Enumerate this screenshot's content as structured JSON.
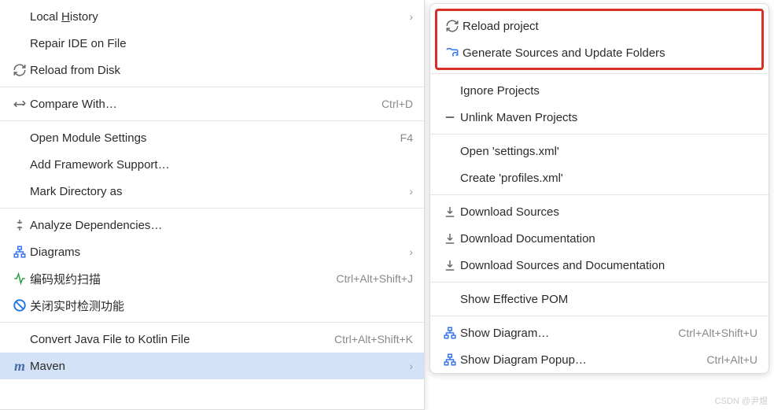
{
  "leftMenu": {
    "localHistory": "Local History",
    "repairIde": "Repair IDE on File",
    "reloadFromDisk": "Reload from Disk",
    "compareWith": "Compare With…",
    "compareWithShortcut": "Ctrl+D",
    "openModuleSettings": "Open Module Settings",
    "openModuleShortcut": "F4",
    "addFramework": "Add Framework Support…",
    "markDirectory": "Mark Directory as",
    "analyzeDeps": "Analyze Dependencies…",
    "diagrams": "Diagrams",
    "codeScan": "编码规约扫描",
    "codeScanShortcut": "Ctrl+Alt+Shift+J",
    "disableRealtime": "关闭实时检测功能",
    "convertKotlin": "Convert Java File to Kotlin File",
    "convertKotlinShortcut": "Ctrl+Alt+Shift+K",
    "maven": "Maven"
  },
  "rightMenu": {
    "reloadProject": "Reload project",
    "generateSources": "Generate Sources and Update Folders",
    "ignoreProjects": "Ignore Projects",
    "unlinkMaven": "Unlink Maven Projects",
    "openSettings": "Open 'settings.xml'",
    "createProfiles": "Create 'profiles.xml'",
    "downloadSources": "Download Sources",
    "downloadDocs": "Download Documentation",
    "downloadBoth": "Download Sources and Documentation",
    "showPom": "Show Effective POM",
    "showDiagram": "Show Diagram…",
    "showDiagramShortcut": "Ctrl+Alt+Shift+U",
    "showDiagramPopup": "Show Diagram Popup…",
    "showDiagramPopupShortcut": "Ctrl+Alt+U"
  },
  "watermark": "CSDN @尹煜"
}
